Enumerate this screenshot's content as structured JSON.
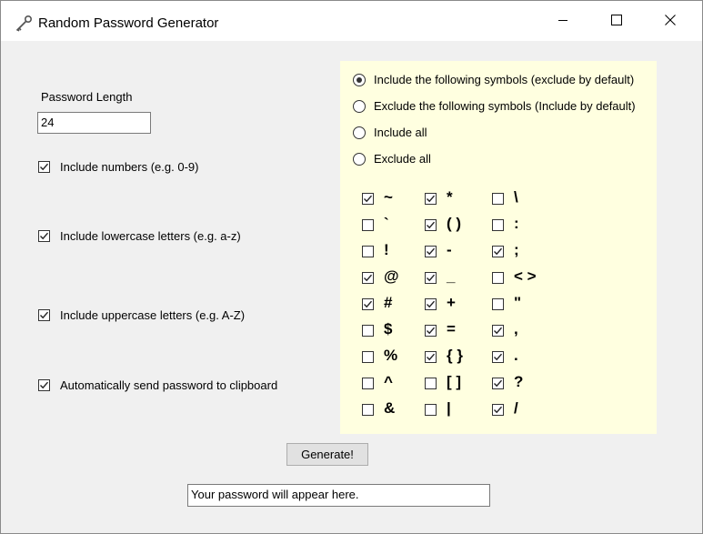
{
  "window": {
    "title": "Random Password Generator"
  },
  "length": {
    "label": "Password Length",
    "value": "24"
  },
  "options": [
    {
      "label": "Include numbers (e.g. 0-9)",
      "checked": true
    },
    {
      "label": "Include lowercase letters (e.g. a-z)",
      "checked": true
    },
    {
      "label": "Include uppercase letters (e.g. A-Z)",
      "checked": true
    },
    {
      "label": "Automatically send password to clipboard",
      "checked": true
    }
  ],
  "modes": [
    {
      "label": "Include the following symbols (exclude by default)",
      "selected": true
    },
    {
      "label": "Exclude the following symbols (Include by default)",
      "selected": false
    },
    {
      "label": "Include all",
      "selected": false
    },
    {
      "label": "Exclude all",
      "selected": false
    }
  ],
  "symbols": [
    [
      {
        "char": "~",
        "checked": true
      },
      {
        "char": "`",
        "checked": false
      },
      {
        "char": "!",
        "checked": false
      },
      {
        "char": "@",
        "checked": true
      },
      {
        "char": "#",
        "checked": true
      },
      {
        "char": "$",
        "checked": false
      },
      {
        "char": "%",
        "checked": false
      },
      {
        "char": "^",
        "checked": false
      },
      {
        "char": "&",
        "checked": false
      }
    ],
    [
      {
        "char": "*",
        "checked": true
      },
      {
        "char": "( )",
        "checked": true
      },
      {
        "char": "-",
        "checked": true
      },
      {
        "char": "_",
        "checked": true
      },
      {
        "char": "+",
        "checked": true
      },
      {
        "char": "=",
        "checked": true
      },
      {
        "char": "{ }",
        "checked": true
      },
      {
        "char": "[ ]",
        "checked": false
      },
      {
        "char": "|",
        "checked": false
      }
    ],
    [
      {
        "char": "\\",
        "checked": false
      },
      {
        "char": ":",
        "checked": false
      },
      {
        "char": ";",
        "checked": true
      },
      {
        "char": "< >",
        "checked": false
      },
      {
        "char": "\"",
        "checked": false
      },
      {
        "char": ",",
        "checked": true
      },
      {
        "char": ".",
        "checked": true
      },
      {
        "char": "?",
        "checked": true
      },
      {
        "char": "/",
        "checked": true
      }
    ]
  ],
  "generate_label": "Generate!",
  "output": {
    "value": "Your password will appear here."
  },
  "colors": {
    "panel": "#ffffe0",
    "background": "#f0f0f0"
  }
}
